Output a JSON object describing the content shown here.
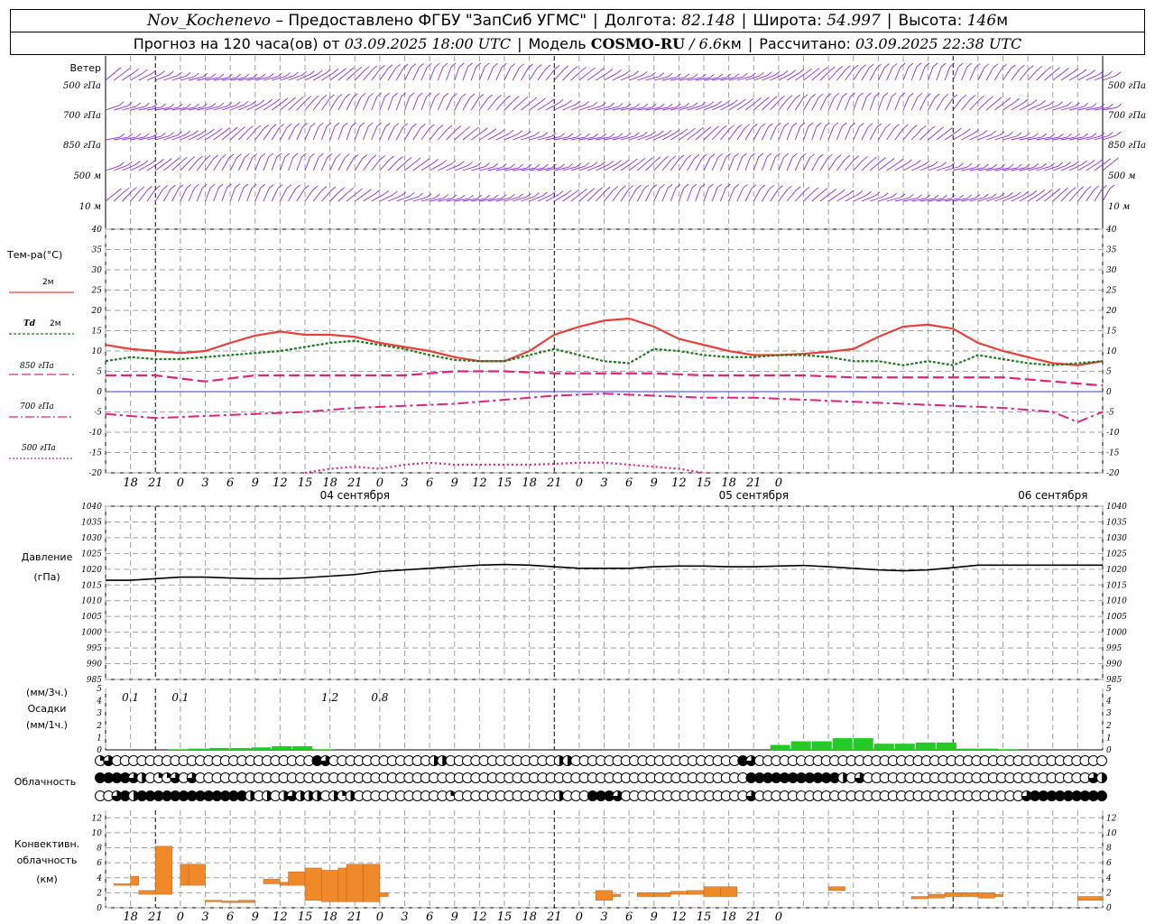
{
  "header": {
    "station": "Nov_Kochenevo",
    "dash": " – ",
    "provided": "Предоставлено ФГБУ \"ЗапСиб УГМС\"",
    "lon_label": "Долгота:",
    "lon": "82.148",
    "lat_label": "Широта:",
    "lat": "54.997",
    "alt_label": "Высота:",
    "alt": "146",
    "alt_unit": "м",
    "forecast_label": "Прогноз на 120 часа(ов) от",
    "forecast_from": "03.09.2025 18:00 UTC",
    "model_label": "Модель",
    "model": "COSMO-RU",
    "resolution": "/ 6.6",
    "res_unit": "км",
    "computed_label": "Рассчитано:",
    "computed": "03.09.2025 22:38 UTC"
  },
  "colors": {
    "wind": "#8a2be2",
    "t2m": "#e8413c",
    "td2m": "#1e7a1e",
    "t850": "#e0247e",
    "t700": "#e0247e",
    "t500": "#e0247e",
    "zero_line": "#3a3aff",
    "pressure": "#000000",
    "precip": "#22cc22",
    "convective": "#f0892a",
    "grid": "#a0a0a0"
  },
  "labels": {
    "wind": "Ветер",
    "wind_levels": [
      "500 гПа",
      "700 гПа",
      "850 гПа",
      "500 м",
      "10  м"
    ],
    "temp": "Тем-ра(°C)",
    "t2m": "2м",
    "td": "Td",
    "td_level": "2м",
    "t850": "850 гПа",
    "t700": "700 гПа",
    "t500": "500 гПа",
    "pressure": "Давление",
    "pressure_unit": "(гПа)",
    "precip_unit3": "(мм/3ч.)",
    "precip": "Осадки",
    "precip_unit1": "(мм/1ч.)",
    "cloud": "Облачность",
    "conv1": "Конвективн.",
    "conv2": "облачность",
    "conv3": "(км)",
    "day1": "04 сентября",
    "day2": "05 сентября",
    "day3": "06 сентября"
  },
  "chart_data": [
    {
      "type": "line",
      "panel": "temperature",
      "x_unit": "hours since 03.09 18 UTC",
      "x_ticks": [
        "18",
        "21",
        "0",
        "3",
        "6",
        "9",
        "12",
        "15",
        "18",
        "21",
        "0",
        "3",
        "6",
        "9",
        "12",
        "15",
        "18",
        "21",
        "0",
        "3",
        "6",
        "9",
        "12",
        "15",
        "18",
        "21",
        "0"
      ],
      "ylim": [
        -20,
        40
      ],
      "y_ticks": [
        -20,
        -15,
        -10,
        -5,
        0,
        5,
        10,
        15,
        20,
        25,
        30,
        35,
        40
      ],
      "series": [
        {
          "name": "2м",
          "key": "t2m",
          "x": [
            0,
            3,
            6,
            9,
            12,
            15,
            18,
            21,
            24,
            27,
            30,
            33,
            36,
            39,
            42,
            45,
            48,
            51,
            54,
            57,
            60,
            63,
            66,
            69,
            72,
            75,
            78,
            81,
            84,
            87,
            90,
            93,
            96,
            99,
            102,
            105,
            108,
            111,
            114,
            117,
            120
          ],
          "values": [
            11.5,
            10.5,
            10,
            9.5,
            10,
            12,
            13.8,
            14.8,
            14,
            14,
            13.5,
            12,
            11,
            10,
            8.5,
            7.5,
            7.5,
            10,
            14,
            16,
            17.5,
            18,
            16,
            13,
            11.5,
            10,
            9,
            9,
            9.3,
            9.8,
            10.5,
            13.5,
            16,
            16.5,
            15.5,
            12,
            10,
            8.5,
            7,
            6.5,
            7.5
          ]
        },
        {
          "name": "Td 2м",
          "key": "td2m",
          "x": [
            0,
            3,
            6,
            9,
            12,
            15,
            18,
            21,
            24,
            27,
            30,
            33,
            36,
            39,
            42,
            45,
            48,
            51,
            54,
            57,
            60,
            63,
            66,
            69,
            72,
            75,
            78,
            81,
            84,
            87,
            90,
            93,
            96,
            99,
            102,
            105,
            108,
            111,
            114,
            117,
            120
          ],
          "values": [
            7.5,
            8.5,
            8,
            8,
            8.5,
            9,
            9.5,
            10,
            11,
            12,
            12.5,
            11.5,
            10.5,
            9,
            7.8,
            7.5,
            7.5,
            9,
            10.5,
            9,
            7.5,
            7,
            10.5,
            10,
            9,
            8.5,
            8.5,
            9,
            9,
            8.5,
            7.5,
            7.5,
            6.5,
            7.5,
            6.5,
            9,
            8,
            7,
            6.5,
            7,
            7.5
          ]
        },
        {
          "name": "850 гПа",
          "key": "t850",
          "x": [
            0,
            6,
            12,
            18,
            24,
            30,
            36,
            42,
            48,
            54,
            60,
            66,
            72,
            78,
            84,
            90,
            96,
            102,
            108,
            114,
            117,
            120
          ],
          "values": [
            4,
            4,
            2.5,
            4,
            4,
            4,
            4,
            5,
            5,
            4.5,
            4.5,
            4.5,
            4,
            4,
            4,
            3.5,
            3.5,
            3.5,
            3.5,
            2.5,
            2,
            1.5
          ]
        },
        {
          "name": "700 гПа",
          "key": "t700",
          "x": [
            0,
            6,
            12,
            18,
            24,
            30,
            36,
            42,
            48,
            54,
            60,
            66,
            72,
            78,
            84,
            90,
            96,
            102,
            108,
            114,
            117,
            120
          ],
          "values": [
            -5.5,
            -6.5,
            -6,
            -5.5,
            -5,
            -4,
            -3.5,
            -3,
            -2,
            -1,
            -0.5,
            -1,
            -1.5,
            -1.5,
            -2,
            -2.5,
            -3,
            -3.5,
            -4,
            -5,
            -7.5,
            -5
          ]
        },
        {
          "name": "500 гПа",
          "key": "t500",
          "x": [
            24,
            27,
            30,
            33,
            36,
            39,
            42,
            45,
            48,
            51,
            54,
            57,
            60,
            63,
            66,
            69,
            72
          ],
          "values": [
            -20,
            -19,
            -18.5,
            -19,
            -18,
            -17.5,
            -18,
            -18,
            -18,
            -18,
            -17.8,
            -17.5,
            -17.5,
            -18,
            -18.5,
            -19,
            -20
          ]
        }
      ]
    },
    {
      "type": "line",
      "panel": "pressure",
      "ylim": [
        985,
        1040
      ],
      "y_ticks": [
        985,
        990,
        995,
        1000,
        1005,
        1010,
        1015,
        1020,
        1025,
        1030,
        1035,
        1040
      ],
      "series": [
        {
          "name": "Давление",
          "key": "pressure",
          "x": [
            0,
            3,
            6,
            9,
            12,
            15,
            18,
            21,
            24,
            27,
            30,
            33,
            36,
            39,
            42,
            45,
            48,
            51,
            54,
            57,
            60,
            63,
            66,
            69,
            72,
            75,
            78,
            81,
            84,
            87,
            90,
            93,
            96,
            99,
            102,
            105,
            108,
            111,
            114,
            117,
            120
          ],
          "values": [
            1016.5,
            1016.5,
            1017,
            1017.5,
            1017.5,
            1017.2,
            1017,
            1017,
            1017.3,
            1017.8,
            1018.3,
            1019.3,
            1019.8,
            1020.3,
            1020.8,
            1021.3,
            1021.5,
            1021.3,
            1020.8,
            1020.3,
            1020.3,
            1020.3,
            1020.8,
            1021,
            1021,
            1020.8,
            1020.8,
            1021,
            1021.2,
            1020.8,
            1020.3,
            1019.8,
            1019.5,
            1019.8,
            1020.5,
            1021.3,
            1021.3,
            1021.3,
            1021.3,
            1021.3,
            1021.3
          ]
        }
      ]
    },
    {
      "type": "bar",
      "panel": "precipitation",
      "ylim": [
        0,
        5
      ],
      "y_ticks": [
        0,
        1,
        2,
        3,
        4,
        5
      ],
      "x": [
        0,
        1,
        2,
        3,
        4,
        5,
        6,
        7,
        8,
        9,
        10,
        11,
        12,
        13,
        14,
        15,
        16,
        17,
        18,
        19,
        20,
        21,
        22,
        23,
        24,
        25,
        26,
        27,
        28,
        29,
        30,
        31,
        32,
        33,
        34,
        35,
        36,
        37,
        38,
        39,
        40,
        41,
        42,
        43,
        44,
        45,
        46,
        47,
        48
      ],
      "values": [
        0,
        0,
        0,
        0.05,
        0.1,
        0.15,
        0.15,
        0.2,
        0.3,
        0.3,
        0.05,
        0,
        0,
        0,
        0,
        0,
        0,
        0,
        0,
        0,
        0,
        0,
        0,
        0,
        0,
        0,
        0,
        0,
        0,
        0,
        0,
        0,
        0.4,
        0.7,
        0.7,
        0.95,
        0.95,
        0.5,
        0.5,
        0.6,
        0.6,
        0.1,
        0.1,
        0.05,
        0,
        0,
        0,
        0,
        0
      ],
      "labels_3h": [
        {
          "x": 6,
          "text": "0.1"
        },
        {
          "x": 18,
          "text": "0.1"
        },
        {
          "x": 54,
          "text": "1.2"
        },
        {
          "x": 66,
          "text": "0.8"
        }
      ]
    },
    {
      "type": "bar",
      "panel": "convective_clouds",
      "ylim": [
        0,
        13
      ],
      "y_ticks": [
        0,
        2,
        4,
        6,
        8,
        10,
        12
      ],
      "bars": [
        {
          "x0": 1,
          "x1": 3,
          "lo": 3,
          "hi": 3.2
        },
        {
          "x0": 3,
          "x1": 4,
          "lo": 3,
          "hi": 4.2
        },
        {
          "x0": 4,
          "x1": 6,
          "lo": 1.8,
          "hi": 2.3
        },
        {
          "x0": 6,
          "x1": 8,
          "lo": 1.8,
          "hi": 8.2
        },
        {
          "x0": 9,
          "x1": 10,
          "lo": 3,
          "hi": 5.8
        },
        {
          "x0": 10,
          "x1": 12,
          "lo": 3,
          "hi": 5.8
        },
        {
          "x0": 12,
          "x1": 14,
          "lo": 0.8,
          "hi": 1
        },
        {
          "x0": 14,
          "x1": 16,
          "lo": 0.7,
          "hi": 0.9
        },
        {
          "x0": 16,
          "x1": 18,
          "lo": 0.7,
          "hi": 1
        },
        {
          "x0": 19,
          "x1": 21,
          "lo": 3.2,
          "hi": 3.8
        },
        {
          "x0": 21,
          "x1": 22,
          "lo": 3,
          "hi": 3.4
        },
        {
          "x0": 22,
          "x1": 24,
          "lo": 3,
          "hi": 4.8
        },
        {
          "x0": 24,
          "x1": 26,
          "lo": 1,
          "hi": 5.3
        },
        {
          "x0": 26,
          "x1": 28,
          "lo": 0.8,
          "hi": 5
        },
        {
          "x0": 28,
          "x1": 29,
          "lo": 0.8,
          "hi": 5.3
        },
        {
          "x0": 29,
          "x1": 31,
          "lo": 0.8,
          "hi": 5.8
        },
        {
          "x0": 31,
          "x1": 33,
          "lo": 0.8,
          "hi": 5.8
        },
        {
          "x0": 33,
          "x1": 34,
          "lo": 1.5,
          "hi": 2
        },
        {
          "x0": 59,
          "x1": 61,
          "lo": 1,
          "hi": 2.3
        },
        {
          "x0": 61,
          "x1": 62,
          "lo": 1.5,
          "hi": 1.8
        },
        {
          "x0": 64,
          "x1": 66,
          "lo": 1.5,
          "hi": 2
        },
        {
          "x0": 66,
          "x1": 68,
          "lo": 1.5,
          "hi": 2
        },
        {
          "x0": 68,
          "x1": 70,
          "lo": 1.8,
          "hi": 2.2
        },
        {
          "x0": 70,
          "x1": 72,
          "lo": 1.8,
          "hi": 2.3
        },
        {
          "x0": 72,
          "x1": 74,
          "lo": 1.5,
          "hi": 2.8
        },
        {
          "x0": 74,
          "x1": 76,
          "lo": 1.5,
          "hi": 2.8
        },
        {
          "x0": 87,
          "x1": 89,
          "lo": 2.3,
          "hi": 2.8
        },
        {
          "x0": 97,
          "x1": 99,
          "lo": 1.2,
          "hi": 1.5
        },
        {
          "x0": 99,
          "x1": 101,
          "lo": 1.3,
          "hi": 1.8
        },
        {
          "x0": 101,
          "x1": 103,
          "lo": 1.5,
          "hi": 2
        },
        {
          "x0": 103,
          "x1": 105,
          "lo": 1.5,
          "hi": 2
        },
        {
          "x0": 105,
          "x1": 107,
          "lo": 1.3,
          "hi": 2
        },
        {
          "x0": 107,
          "x1": 108,
          "lo": 1.5,
          "hi": 1.8
        },
        {
          "x0": 117,
          "x1": 120,
          "lo": 1,
          "hi": 1.5
        }
      ]
    }
  ],
  "cloud_cover": {
    "levels": [
      "high",
      "mid",
      "low"
    ],
    "high": [
      1,
      3,
      0,
      0,
      0,
      0,
      0,
      0,
      0,
      0,
      0,
      0,
      0,
      0,
      0,
      0,
      0,
      0,
      0,
      0,
      0,
      0,
      0,
      0,
      0,
      0,
      4,
      3,
      0,
      0,
      0,
      0,
      0,
      0,
      0,
      0,
      0,
      0,
      0,
      0,
      2,
      2,
      0,
      0,
      0,
      0,
      0,
      0,
      0,
      0,
      0,
      0,
      0,
      0,
      0,
      2,
      2,
      0,
      0,
      0,
      0,
      0,
      0,
      0,
      0,
      0,
      0,
      0,
      0,
      0,
      0,
      0,
      0,
      0,
      0,
      0,
      0,
      4,
      3,
      0,
      0,
      0,
      0,
      0,
      0,
      0,
      0,
      0,
      0,
      0,
      0,
      0,
      0,
      0,
      0,
      0,
      0,
      0,
      0,
      0,
      0,
      0,
      0,
      0,
      0,
      0,
      0,
      0,
      0,
      0,
      0,
      0,
      0,
      0,
      0,
      0,
      0,
      0,
      0,
      0,
      0
    ],
    "mid": [
      4,
      4,
      4,
      4,
      3,
      2,
      0,
      1,
      1,
      3,
      0,
      3,
      0,
      0,
      0,
      0,
      0,
      0,
      0,
      0,
      0,
      0,
      0,
      0,
      0,
      0,
      0,
      0,
      0,
      0,
      0,
      0,
      0,
      0,
      0,
      0,
      0,
      0,
      0,
      0,
      0,
      0,
      0,
      0,
      0,
      0,
      0,
      0,
      0,
      0,
      0,
      0,
      0,
      0,
      0,
      0,
      0,
      0,
      0,
      0,
      0,
      0,
      0,
      0,
      0,
      0,
      0,
      0,
      0,
      0,
      0,
      0,
      0,
      0,
      0,
      0,
      0,
      0,
      4,
      4,
      4,
      4,
      4,
      4,
      4,
      4,
      4,
      4,
      4,
      2,
      0,
      3,
      0,
      0,
      0,
      0,
      0,
      0,
      0,
      0,
      0,
      0,
      0,
      0,
      0,
      0,
      0,
      0,
      0,
      0,
      0,
      0,
      0,
      0,
      0,
      0,
      0,
      0,
      0,
      3,
      2
    ],
    "low": [
      0,
      0,
      3,
      4,
      2,
      4,
      4,
      4,
      4,
      4,
      4,
      4,
      4,
      4,
      4,
      4,
      4,
      4,
      2,
      0,
      2,
      0,
      2,
      3,
      2,
      2,
      2,
      0,
      2,
      1,
      2,
      0,
      0,
      0,
      0,
      0,
      0,
      0,
      0,
      0,
      0,
      0,
      1,
      0,
      0,
      0,
      0,
      0,
      0,
      0,
      0,
      0,
      0,
      0,
      0,
      2,
      0,
      0,
      0,
      4,
      4,
      4,
      3,
      0,
      0,
      0,
      0,
      0,
      0,
      0,
      0,
      0,
      0,
      0,
      0,
      0,
      0,
      0,
      3,
      0,
      0,
      0,
      0,
      0,
      0,
      0,
      0,
      0,
      0,
      0,
      0,
      0,
      0,
      0,
      0,
      0,
      0,
      0,
      0,
      0,
      0,
      0,
      0,
      0,
      0,
      0,
      0,
      0,
      0,
      0,
      0,
      3,
      4,
      4,
      4,
      4,
      4,
      4,
      4,
      4,
      4
    ]
  }
}
